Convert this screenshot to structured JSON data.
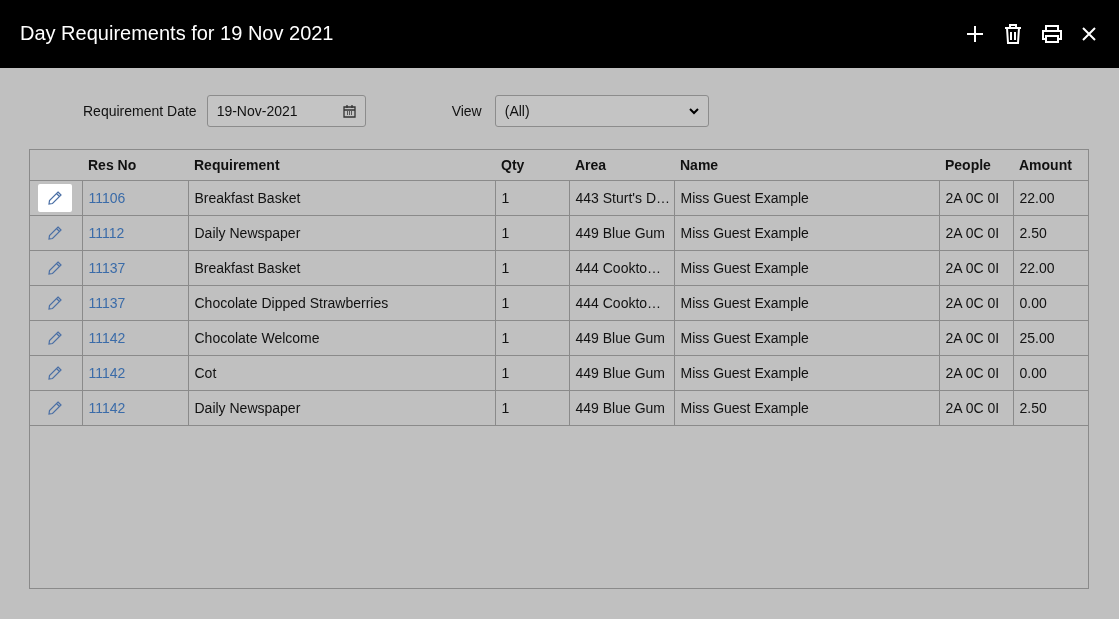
{
  "window": {
    "title": "Day Requirements for 19 Nov 2021"
  },
  "filters": {
    "date_label": "Requirement Date",
    "date_value": "19-Nov-2021",
    "view_label": "View",
    "view_value": "(All)"
  },
  "table": {
    "columns": [
      "Res No",
      "Requirement",
      "Qty",
      "Area",
      "Name",
      "People",
      "Amount"
    ],
    "rows": [
      {
        "focused": true,
        "res_no": "11106",
        "requirement": "Breakfast Basket",
        "qty": "1",
        "area": "443 Sturt's D…",
        "name": "Miss Guest Example",
        "people": "2A 0C 0I",
        "amount": "22.00"
      },
      {
        "focused": false,
        "res_no": "11112",
        "requirement": "Daily Newspaper",
        "qty": "1",
        "area": "449 Blue Gum",
        "name": "Miss Guest Example",
        "people": "2A 0C 0I",
        "amount": "2.50"
      },
      {
        "focused": false,
        "res_no": "11137",
        "requirement": "Breakfast Basket",
        "qty": "1",
        "area": "444 Cookto…",
        "name": "Miss Guest Example",
        "people": "2A 0C 0I",
        "amount": "22.00"
      },
      {
        "focused": false,
        "res_no": "11137",
        "requirement": "Chocolate Dipped Strawberries",
        "qty": "1",
        "area": "444 Cookto…",
        "name": "Miss Guest Example",
        "people": "2A 0C 0I",
        "amount": "0.00"
      },
      {
        "focused": false,
        "res_no": "11142",
        "requirement": "Chocolate Welcome",
        "qty": "1",
        "area": "449 Blue Gum",
        "name": "Miss Guest Example",
        "people": "2A 0C 0I",
        "amount": "25.00"
      },
      {
        "focused": false,
        "res_no": "11142",
        "requirement": "Cot",
        "qty": "1",
        "area": "449 Blue Gum",
        "name": "Miss Guest Example",
        "people": "2A 0C 0I",
        "amount": "0.00"
      },
      {
        "focused": false,
        "res_no": "11142",
        "requirement": "Daily Newspaper",
        "qty": "1",
        "area": "449 Blue Gum",
        "name": "Miss Guest Example",
        "people": "2A 0C 0I",
        "amount": "2.50"
      }
    ]
  }
}
